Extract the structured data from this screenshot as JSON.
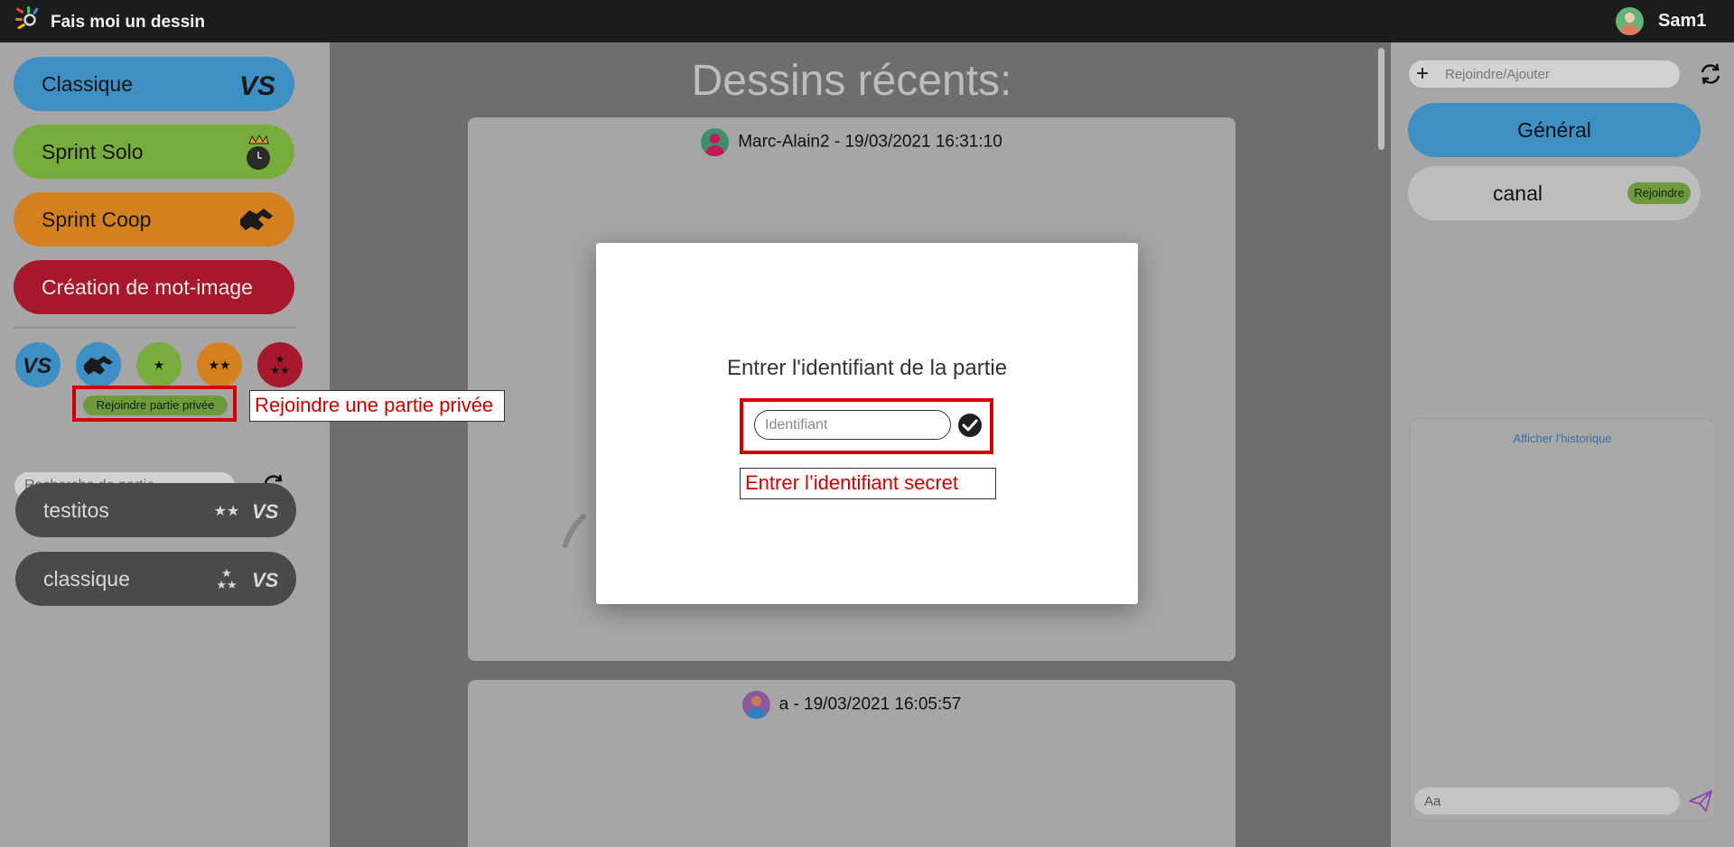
{
  "app": {
    "title": "Fais moi un dessin"
  },
  "user": {
    "name": "Sam1"
  },
  "modes": {
    "classique": "Classique",
    "sprint_solo": "Sprint Solo",
    "sprint_coop": "Sprint Coop",
    "creation": "Création de mot-image"
  },
  "filters": [
    "vs",
    "coop",
    "difficulty-1-star",
    "difficulty-2-stars",
    "difficulty-3-stars"
  ],
  "private_join": {
    "button_label": "Rejoindre partie privée",
    "annotation": "Rejoindre une partie privée"
  },
  "party_search": {
    "placeholder": "Recherche de partie"
  },
  "games": [
    {
      "name": "testitos",
      "difficulty": 2,
      "mode": "VS"
    },
    {
      "name": "classique",
      "difficulty": 3,
      "mode": "VS"
    }
  ],
  "center": {
    "title": "Dessins récents:",
    "drawings": [
      {
        "header": "Marc-Alain2 - 19/03/2021 16:31:10"
      },
      {
        "header": "a - 19/03/2021 16:05:57"
      }
    ]
  },
  "chat": {
    "join_placeholder": "Rejoindre/Ajouter",
    "channels": [
      {
        "name": "Général"
      },
      {
        "name": "canal",
        "action": "Rejoindre"
      }
    ],
    "history_link": "Afficher l'historique",
    "message_placeholder": "Aa"
  },
  "modal": {
    "title": "Entrer l'identifiant de la partie",
    "input_placeholder": "Identifiant",
    "annotation": "Entrer l’identifiant secret"
  },
  "colors": {
    "blue": "#3d8fc4",
    "green": "#77ad3c",
    "orange": "#d4801f",
    "red": "#a8182d",
    "annotation_red": "#d40000"
  }
}
